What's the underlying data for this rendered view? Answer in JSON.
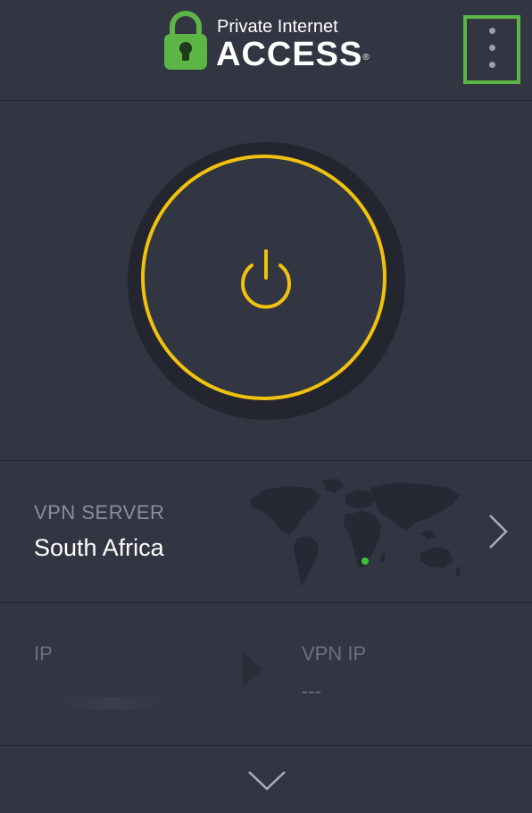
{
  "header": {
    "logo_small": "Private Internet",
    "logo_big": "ACCESS",
    "logo_reg": "®"
  },
  "power": {
    "state_color": "#f0c20e"
  },
  "region": {
    "label": "VPN SERVER",
    "value": "South Africa"
  },
  "ip": {
    "label": "IP",
    "vpn_label": "VPN IP",
    "vpn_value": "---"
  },
  "colors": {
    "background": "#323542",
    "accent_green": "#5cb545",
    "power_yellow": "#f0c20e",
    "location_dot": "#3ec531"
  },
  "icons": {
    "logo": "padlock-robot-icon",
    "menu": "more-vertical-icon",
    "power": "power-icon",
    "map": "world-map-icon",
    "next": "chevron-right-icon",
    "arrow": "arrow-right-icon",
    "expand": "chevron-down-icon"
  }
}
